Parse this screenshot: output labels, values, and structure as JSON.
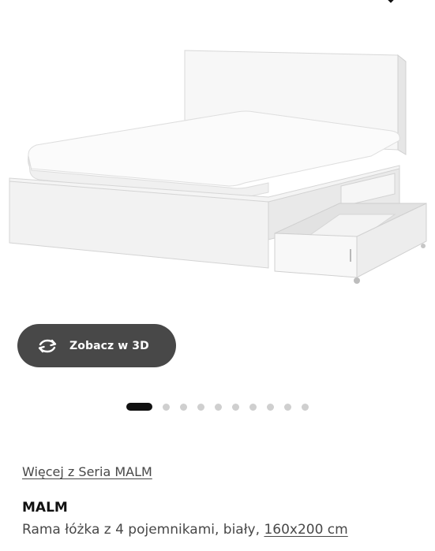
{
  "gallery": {
    "image_alt": "",
    "view_3d_label": "Zobacz w 3D",
    "dot_count": 10,
    "active_dot": 0
  },
  "product": {
    "series_link": "Więcej z Seria MALM",
    "name": "MALM",
    "description": "Rama łóżka z 4 pojemnikami, biały,",
    "size_link": "160x200 cm"
  },
  "colors": {
    "button_bg": "#484848",
    "active_dot": "#111111",
    "inactive_dot": "#cfcfcf",
    "text_secondary": "#484848"
  }
}
